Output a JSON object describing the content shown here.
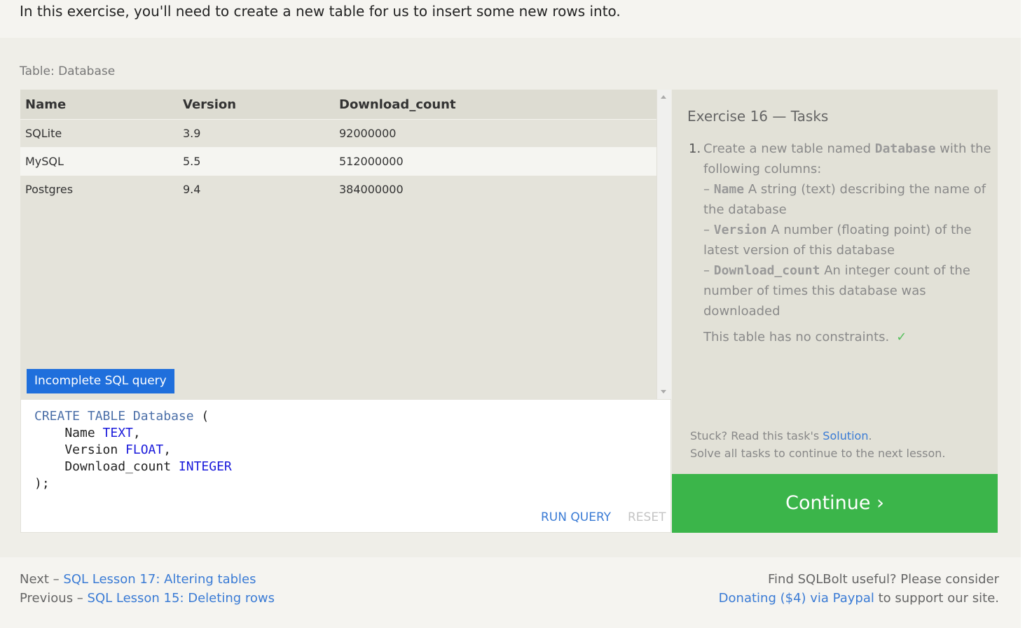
{
  "intro": {
    "text": "In this exercise, you'll need to create a new table for us to insert some new rows into."
  },
  "table": {
    "caption": "Table: Database",
    "columns": [
      "Name",
      "Version",
      "Download_count"
    ],
    "rows": [
      [
        "SQLite",
        "3.9",
        "92000000"
      ],
      [
        "MySQL",
        "5.5",
        "512000000"
      ],
      [
        "Postgres",
        "9.4",
        "384000000"
      ]
    ]
  },
  "status": {
    "label": "Incomplete SQL query",
    "color": "#1f6fdc"
  },
  "editor": {
    "code_lines": [
      "CREATE TABLE Database (",
      "    Name TEXT,",
      "    Version FLOAT,",
      "    Download_count INTEGER",
      ");"
    ],
    "run_label": "RUN QUERY",
    "reset_label": "RESET"
  },
  "tasks": {
    "title": "Exercise 16 — Tasks",
    "item_number": "1.",
    "item_intro": "Create a new table named",
    "item_table": "Database",
    "item_intro_end": "with the following columns:",
    "columns": [
      {
        "name": "Name",
        "desc": "A string (text) describing the name of the database"
      },
      {
        "name": "Version",
        "desc": "A number (floating point) of the latest version of this database"
      },
      {
        "name": "Download_count",
        "desc": "An integer count of the number of times this database was downloaded"
      }
    ],
    "constraints": "This table has no constraints.",
    "check_icon": "check-icon",
    "stuck_prefix": "Stuck? Read this task's",
    "solution_link": "Solution",
    "stuck_suffix": ".",
    "solve_all": "Solve all tasks to continue to the next lesson."
  },
  "continue": {
    "label": "Continue ›",
    "color": "#3bb54a"
  },
  "footer": {
    "next_prefix": "Next –",
    "next_link": "SQL Lesson 17: Altering tables",
    "prev_prefix": "Previous –",
    "prev_link": "SQL Lesson 15: Deleting rows",
    "find_text": "Find SQLBolt useful? Please consider",
    "donate_link": "Donating ($4) via Paypal",
    "support_text": "to support our site."
  }
}
